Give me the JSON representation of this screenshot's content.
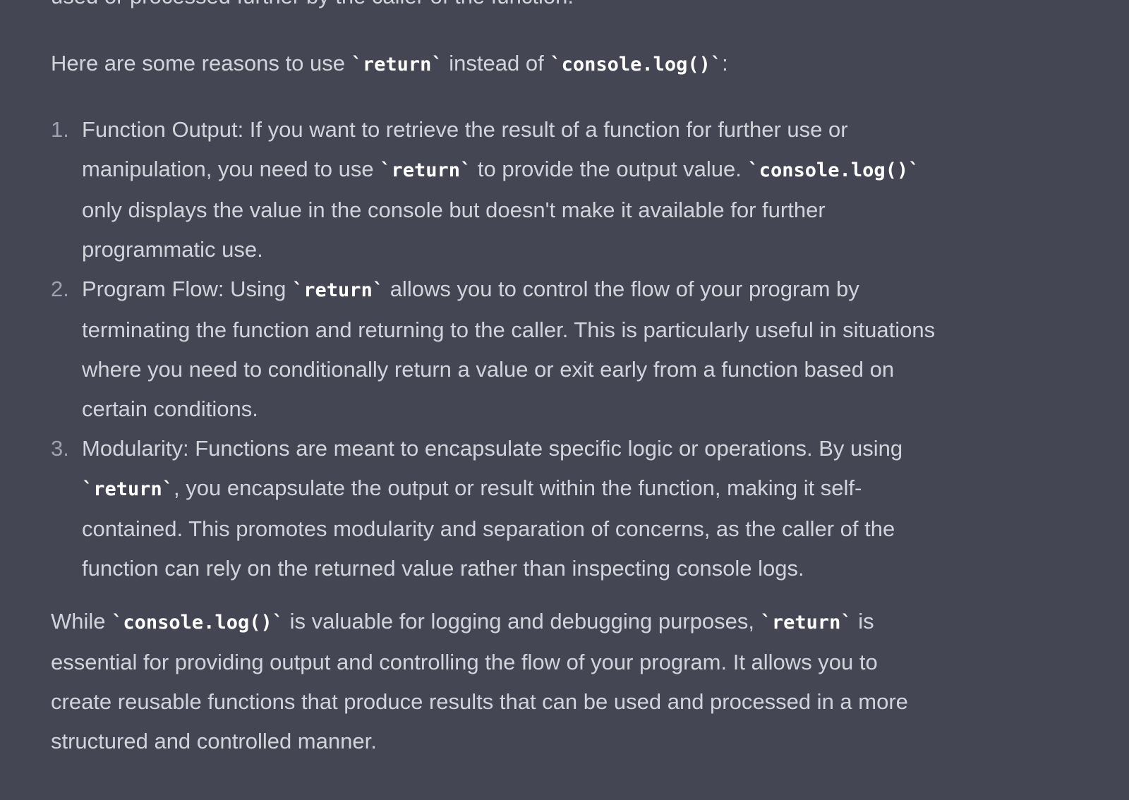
{
  "message": {
    "cut_line": "used or processed further by the caller of the function.",
    "intro": {
      "before": "Here are some reasons to use ",
      "code1": "`return`",
      "middle": " instead of ",
      "code2": "`console.log()`",
      "after": ":"
    },
    "list": [
      {
        "number": "1.",
        "lines": [
          {
            "text": "Function Output: If you want to retrieve the result of a function for further use or"
          },
          {
            "t1": "manipulation, you need to use ",
            "c1": "`return`",
            "t2": " to provide the output value. ",
            "c2": "`console.log()`"
          },
          {
            "text": "only displays the value in the console but doesn't make it available for further"
          },
          {
            "text": "programmatic use."
          }
        ]
      },
      {
        "number": "2.",
        "lines": [
          {
            "t1": "Program Flow: Using ",
            "c1": "`return`",
            "t2": " allows you to control the flow of your program by"
          },
          {
            "text": "terminating the function and returning to the caller. This is particularly useful in situations"
          },
          {
            "text": "where you need to conditionally return a value or exit early from a function based on"
          },
          {
            "text": "certain conditions."
          }
        ]
      },
      {
        "number": "3.",
        "lines": [
          {
            "text": "Modularity: Functions are meant to encapsulate specific logic or operations. By using"
          },
          {
            "c1": "`return`",
            "t2": ", you encapsulate the output or result within the function, making it self-"
          },
          {
            "text": "contained. This promotes modularity and separation of concerns, as the caller of the"
          },
          {
            "text": "function can rely on the returned value rather than inspecting console logs."
          }
        ]
      }
    ],
    "closing": {
      "l1_t1": "While ",
      "l1_c1": "`console.log()`",
      "l1_t2": " is valuable for logging and debugging purposes, ",
      "l1_c2": "`return`",
      "l1_t3": " is",
      "l2": "essential for providing output and controlling the flow of your program. It allows you to",
      "l3": "create reusable functions that produce results that can be used and processed in a more",
      "l4": "structured and controlled manner."
    }
  }
}
